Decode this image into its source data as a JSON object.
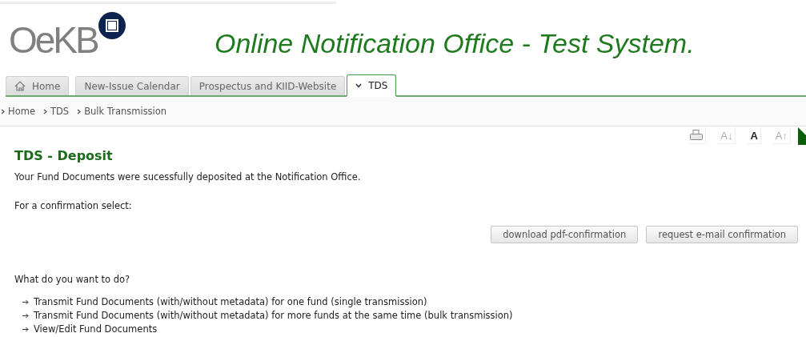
{
  "logo": {
    "text": "OeKB"
  },
  "title": "Online Notification Office - Test System.",
  "tabs": [
    {
      "label": "Home",
      "kind": "home",
      "selected": false
    },
    {
      "label": "New-Issue Calendar",
      "kind": "plain",
      "selected": false
    },
    {
      "label": "Prospectus and KIID-Website",
      "kind": "plain",
      "selected": false
    },
    {
      "label": "TDS",
      "kind": "menu",
      "selected": true
    }
  ],
  "breadcrumb": [
    "Home",
    "TDS",
    "Bulk Transmission"
  ],
  "tools": [
    {
      "kind": "print"
    },
    {
      "kind": "text",
      "label": "A↓",
      "disabled": true
    },
    {
      "kind": "text",
      "label": "A",
      "disabled": false
    },
    {
      "kind": "text",
      "label": "A↑",
      "disabled": true
    }
  ],
  "heading": "TDS - Deposit",
  "message": "Your Fund Documents were sucessfully deposited at the Notification Office.",
  "confirm_prompt": "For a confirmation select:",
  "buttons": [
    "download pdf-confirmation",
    "request e-mail confirmation"
  ],
  "question": "What do you want to do?",
  "links": [
    "Transmit Fund Documents (with/without metadata) for one fund (single transmission)",
    "Transmit Fund Documents (with/without metadata) for more funds at the same time (bulk transmission)",
    "View/Edit Fund Documents"
  ]
}
